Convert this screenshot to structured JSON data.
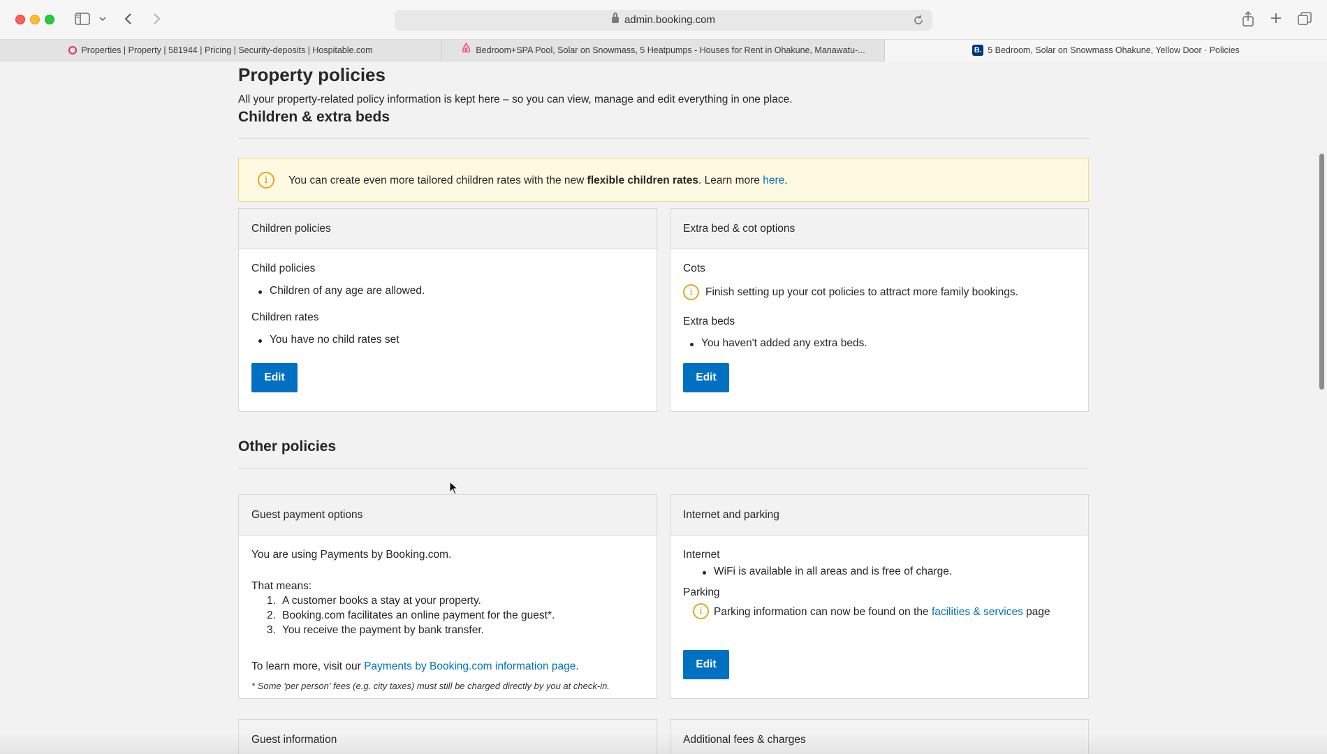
{
  "browser": {
    "address": "admin.booking.com",
    "tabs": [
      {
        "label": "Properties | Property | 581944 | Pricing | Security-deposits | Hospitable.com",
        "icon": "hospitable-icon"
      },
      {
        "label": "Bedroom+SPA Pool, Solar on Snowmass, 5 Heatpumps - Houses for Rent in Ohakune, Manawatu-...",
        "icon": "airbnb-icon"
      },
      {
        "label": "5 Bedroom, Solar on Snowmass Ohakune, Yellow Door · Policies",
        "icon": "booking-icon",
        "active": true
      }
    ]
  },
  "page": {
    "title": "Property policies",
    "description": "All your property-related policy information is kept here – so you can view, manage and edit everything in one place."
  },
  "children_section": {
    "title": "Children & extra beds",
    "banner": {
      "prefix": "You can create even more tailored children rates with the new ",
      "bold": "flexible children rates",
      "middle": ". Learn more ",
      "link": "here",
      "suffix": "."
    },
    "children_card": {
      "title": "Children policies",
      "child_policies_label": "Child policies",
      "child_policies_item": "Children of any age are allowed.",
      "children_rates_label": "Children rates",
      "children_rates_item": "You have no child rates set",
      "edit": "Edit"
    },
    "extra_bed_card": {
      "title": "Extra bed & cot options",
      "cots_label": "Cots",
      "cots_notice": "Finish setting up your cot policies to attract more family bookings.",
      "extra_beds_label": "Extra beds",
      "extra_beds_item": "You haven't added any extra beds.",
      "edit": "Edit"
    }
  },
  "other_section": {
    "title": "Other policies",
    "payment_card": {
      "title": "Guest payment options",
      "intro": "You are using Payments by Booking.com.",
      "means": "That means:",
      "steps": [
        "A customer books a stay at your property.",
        "Booking.com facilitates an online payment for the guest*.",
        "You receive the payment by bank transfer."
      ],
      "learn_prefix": "To learn more, visit our ",
      "learn_link": "Payments by Booking.com information page",
      "learn_suffix": ".",
      "footnote": "* Some 'per person' fees (e.g. city taxes) must still be charged directly by you at check-in."
    },
    "internet_card": {
      "title": "Internet and parking",
      "internet_label": "Internet",
      "internet_item": "WiFi is available in all areas and is free of charge.",
      "parking_label": "Parking",
      "parking_prefix": "Parking information can now be found on the ",
      "parking_link": "facilities & services",
      "parking_suffix": " page",
      "edit": "Edit"
    },
    "guest_info_card": {
      "title": "Guest information"
    },
    "fees_card": {
      "title": "Additional fees & charges"
    }
  },
  "step_numbers": [
    "1.",
    "2.",
    "3."
  ]
}
